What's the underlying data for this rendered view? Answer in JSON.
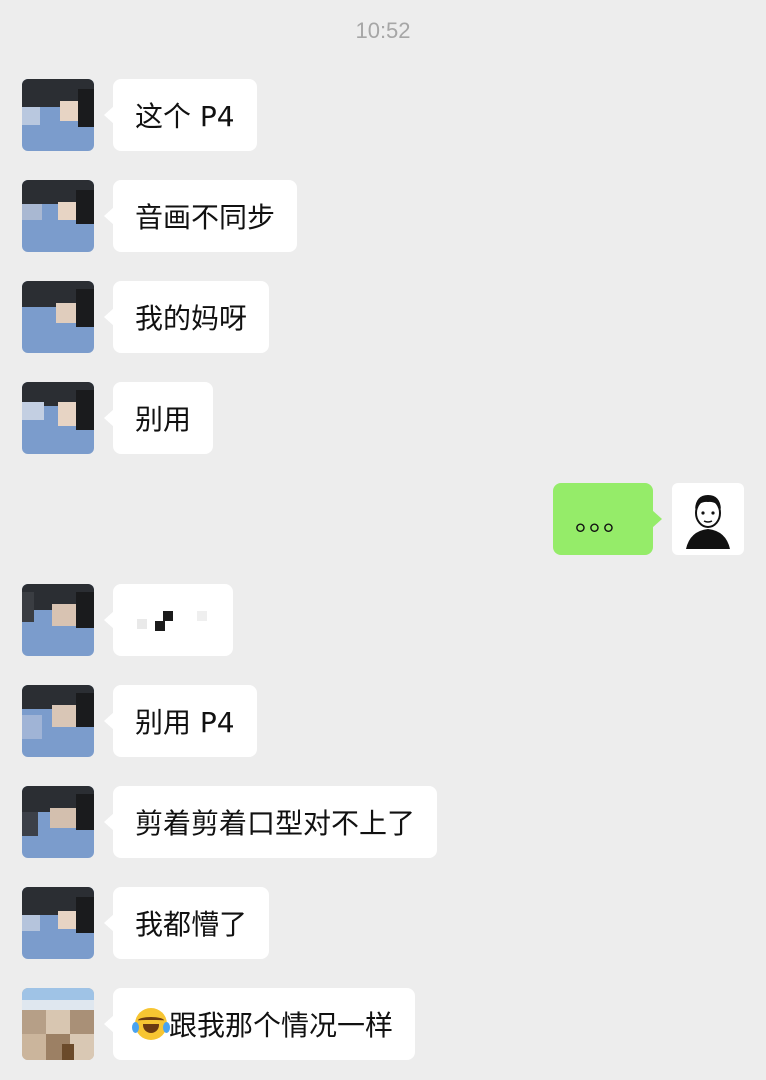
{
  "chat": {
    "timestamp": "10:52",
    "messages": [
      {
        "from": "other",
        "text": "这个 P4"
      },
      {
        "from": "other",
        "text": "音画不同步"
      },
      {
        "from": "other",
        "text": "我的妈呀"
      },
      {
        "from": "other",
        "text": "别用"
      },
      {
        "from": "me",
        "text": "。。。"
      },
      {
        "from": "other",
        "text": ""
      },
      {
        "from": "other",
        "text": "别用 P4"
      },
      {
        "from": "other",
        "text": "剪着剪着口型对不上了"
      },
      {
        "from": "other",
        "text": "我都懵了"
      },
      {
        "from": "other",
        "emoji": "face-with-tears-of-joy-icon",
        "text": "跟我那个情况一样"
      }
    ]
  },
  "colors": {
    "background": "#ededed",
    "bubble_other": "#ffffff",
    "bubble_me": "#95ec69",
    "timestamp": "#a6a6a6"
  }
}
